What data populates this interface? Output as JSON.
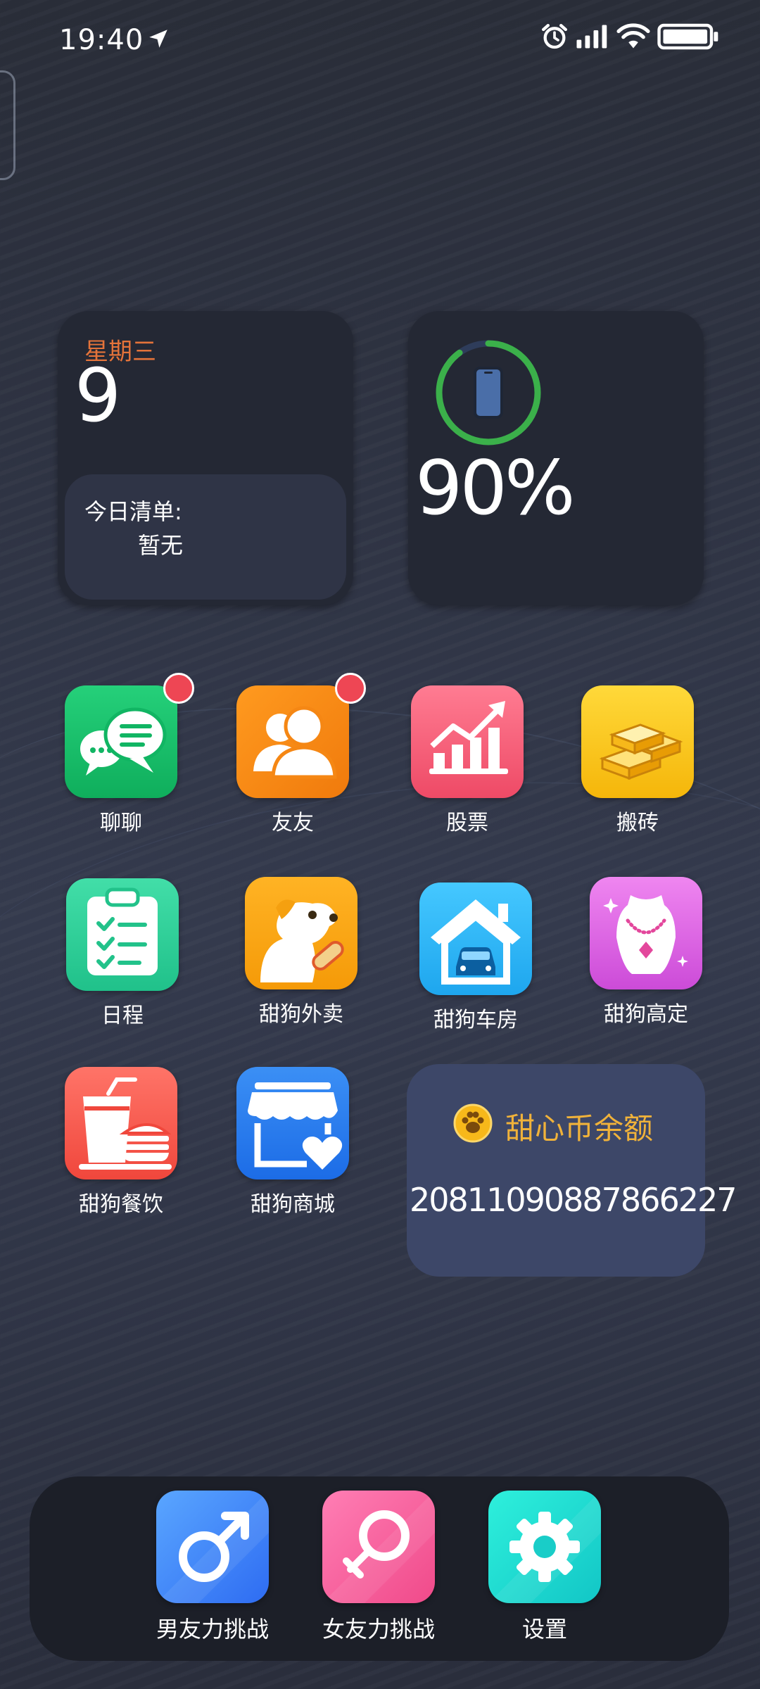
{
  "status_bar": {
    "time": "19:40",
    "icons": [
      "location-arrow-icon",
      "alarm-icon",
      "signal-icon",
      "wifi-icon",
      "battery-icon"
    ]
  },
  "calendar_widget": {
    "weekday": "星期三",
    "day": "9",
    "todo_title": "今日清单:",
    "todo_value": "暂无",
    "weekday_color": "#e4733a"
  },
  "battery_widget": {
    "percent_text": "90%",
    "level": 0.9,
    "ring_color": "#3bb04a"
  },
  "apps": [
    {
      "label": "聊聊",
      "icon": "chat-bubbles-icon",
      "badge": true
    },
    {
      "label": "友友",
      "icon": "friends-icon",
      "badge": true
    },
    {
      "label": "股票",
      "icon": "stock-chart-icon",
      "badge": false
    },
    {
      "label": "搬砖",
      "icon": "gold-bars-icon",
      "badge": false
    },
    {
      "label": "日程",
      "icon": "clipboard-checklist-icon",
      "badge": false
    },
    {
      "label": "甜狗外卖",
      "icon": "dog-takeout-icon",
      "badge": false
    },
    {
      "label": "甜狗车房",
      "icon": "house-car-icon",
      "badge": false
    },
    {
      "label": "甜狗高定",
      "icon": "necklace-icon",
      "badge": false
    },
    {
      "label": "甜狗餐饮",
      "icon": "drink-burger-icon",
      "badge": false
    },
    {
      "label": "甜狗商城",
      "icon": "shop-heart-icon",
      "badge": false
    }
  ],
  "coin_widget": {
    "title": "甜心币余额",
    "amount": "20811090887866227",
    "title_color": "#f0b23a"
  },
  "dock": [
    {
      "label": "男友力挑战",
      "icon": "male-symbol-icon"
    },
    {
      "label": "女友力挑战",
      "icon": "female-symbol-icon"
    },
    {
      "label": "设置",
      "icon": "gear-icon"
    }
  ]
}
